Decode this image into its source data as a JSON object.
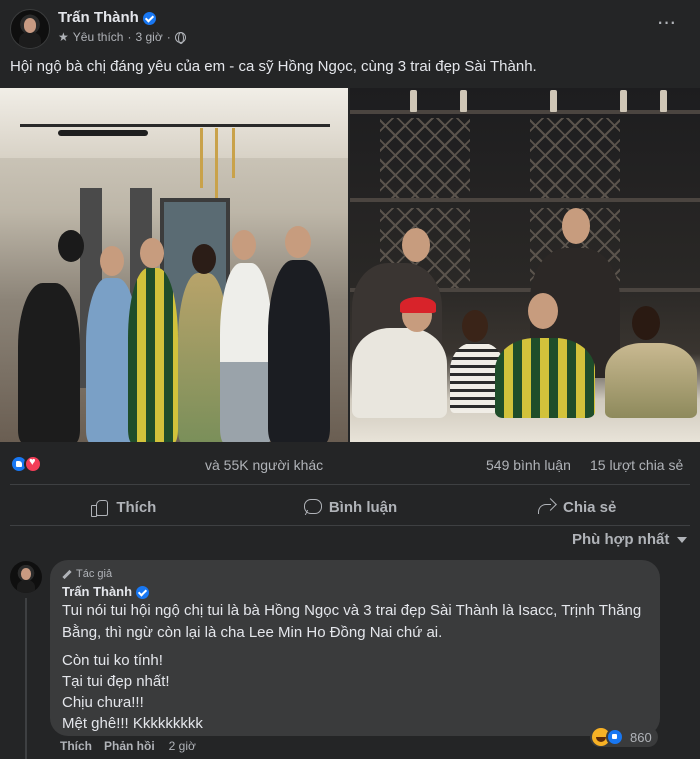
{
  "post": {
    "author": "Trấn Thành",
    "follow_label": "Yêu thích",
    "time": "3 giờ",
    "more_label": "···",
    "caption": "Hội ngộ bà chị đáng yêu của em - ca sỹ Hồng Ngọc, cùng 3 trai đẹp Sài Thành.",
    "icons": [
      "verified-badge",
      "star-icon",
      "globe-icon",
      "more-options-icon"
    ]
  },
  "photos": [
    {
      "name": "photo-restaurant-group-standing"
    },
    {
      "name": "photo-wine-bar-group-seated"
    }
  ],
  "stats": {
    "reaction_text": "và 55K người khác",
    "comments": "549 bình luận",
    "shares": "15 lượt chia sẻ",
    "reaction_icons": [
      "like",
      "love"
    ]
  },
  "actions": {
    "like": "Thích",
    "comment": "Bình luận",
    "share": "Chia sẻ"
  },
  "sort": {
    "label": "Phù hợp nhất"
  },
  "comment": {
    "badge": "Tác giả",
    "author": "Trấn Thành",
    "lines": [
      "Tui nói tui hội ngộ chị tui là bà Hồng Ngọc và 3 trai đẹp Sài Thành là Isacc, Trịnh Thăng",
      "Bằng, thì ngừ còn lại là cha Lee Min Ho Đồng Nai chứ ai.",
      "Còn tui ko tính!",
      "Tại tui đẹp nhất!",
      "Chịu chưa!!!",
      "Mệt ghê!!! Kkkkkkkkk"
    ],
    "like_label": "Thích",
    "reply_label": "Phản hồi",
    "time": "2 giờ",
    "reaction_count": "860",
    "colors": {
      "bubble": "#3a3b3c",
      "link_blue": "#1877f2"
    }
  },
  "theme": {
    "background": "#242526",
    "text": "#e4e6eb",
    "muted": "#b0b3b8"
  }
}
